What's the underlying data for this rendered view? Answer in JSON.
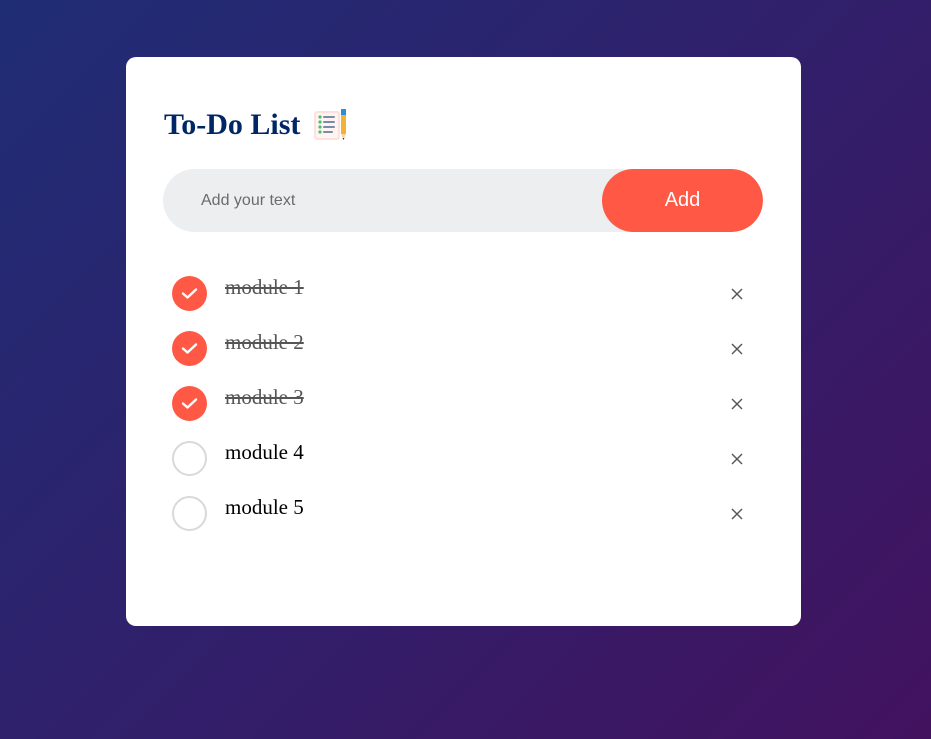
{
  "app": {
    "title": "To-Do List",
    "title_icon": "notepad-checklist-icon"
  },
  "colors": {
    "accent": "#ff5945",
    "title": "#002765",
    "input_bg": "#edeef0",
    "background_from": "#1f2d75",
    "background_to": "#42125f"
  },
  "input": {
    "value": "",
    "placeholder": "Add your text"
  },
  "add_button": {
    "label": "Add"
  },
  "tasks": [
    {
      "text": "module 1",
      "checked": true,
      "remove_icon": "close-icon"
    },
    {
      "text": "module 2",
      "checked": true,
      "remove_icon": "close-icon"
    },
    {
      "text": "module 3",
      "checked": true,
      "remove_icon": "close-icon"
    },
    {
      "text": "module 4",
      "checked": false,
      "remove_icon": "close-icon"
    },
    {
      "text": "module 5",
      "checked": false,
      "remove_icon": "close-icon"
    }
  ]
}
